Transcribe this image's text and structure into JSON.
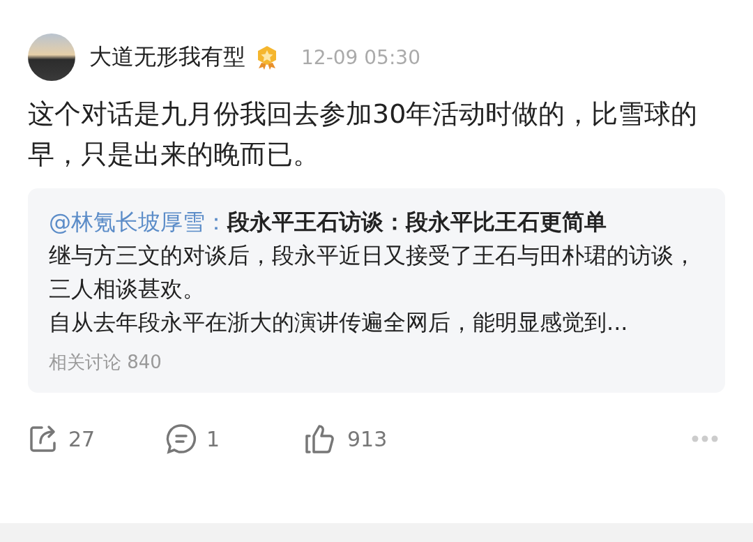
{
  "post": {
    "author": "大道无形我有型",
    "time": "12-09 05:30",
    "text": "这个对话是九月份我回去参加30年活动时做的，比雪球的早，只是出来的晚而已。"
  },
  "quote": {
    "mention": "@林氪长坡厚雪：",
    "title": "段永平王石访谈：段永平比王石更简单",
    "paragraphs": [
      "继与方三文的对谈后，段永平近日又接受了王石与田朴珺的访谈，三人相谈甚欢。",
      "自从去年段永平在浙大的演讲传遍全网后，能明显感觉到..."
    ],
    "related": "相关讨论 840"
  },
  "actions": [
    {
      "kind": "share",
      "count": "27"
    },
    {
      "kind": "comment",
      "count": "1"
    },
    {
      "kind": "like",
      "count": "913"
    }
  ]
}
